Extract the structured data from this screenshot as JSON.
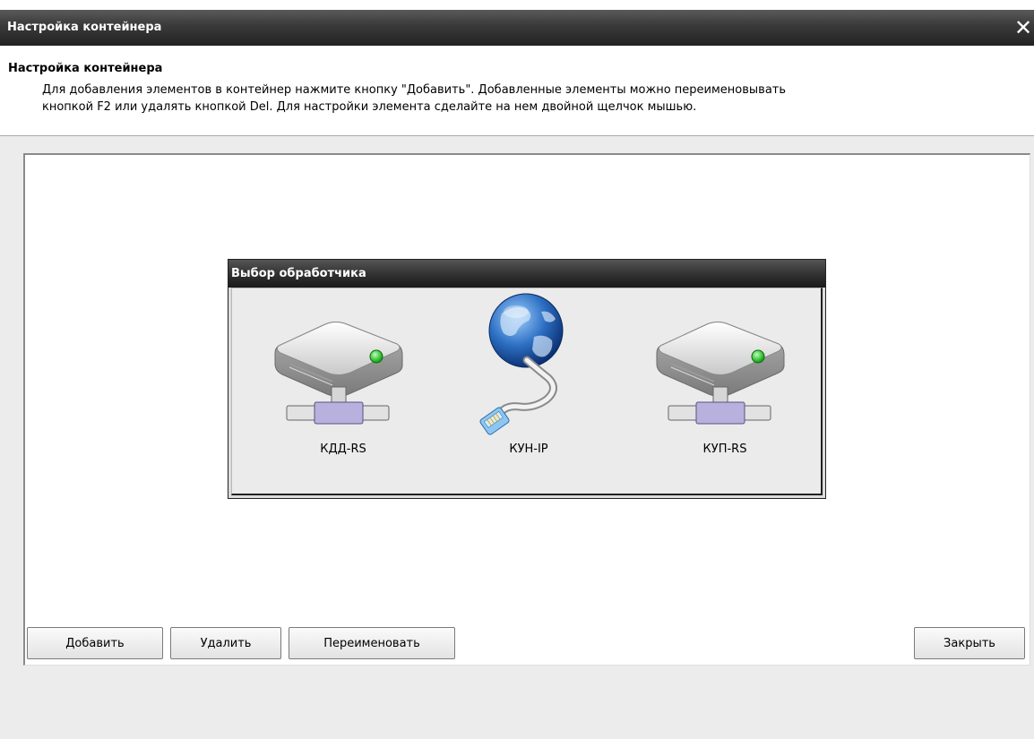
{
  "window": {
    "title": "Настройка контейнера",
    "close_glyph": "✕"
  },
  "header": {
    "title": "Настройка контейнера",
    "description_line1": "Для добавления элементов в контейнер нажмите кнопку \"Добавить\". Добавленные элементы можно переименовывать",
    "description_line2": "кнопкой F2 или удалять кнопкой Del. Для настройки элемента сделайте на нем двойной щелчок мышью."
  },
  "dialog": {
    "title": "Выбор обработчика",
    "handlers": [
      {
        "label": "КДД-RS",
        "icon": "network-drive-icon"
      },
      {
        "label": "КУН-IP",
        "icon": "globe-network-icon"
      },
      {
        "label": "КУП-RS",
        "icon": "network-drive-icon"
      }
    ]
  },
  "buttons": {
    "add": "Добавить",
    "delete": "Удалить",
    "rename": "Переименовать",
    "close": "Закрыть"
  },
  "colors": {
    "title_bar": "#333333",
    "drive_led": "#22cc22",
    "connector": "#b8b0dd"
  }
}
